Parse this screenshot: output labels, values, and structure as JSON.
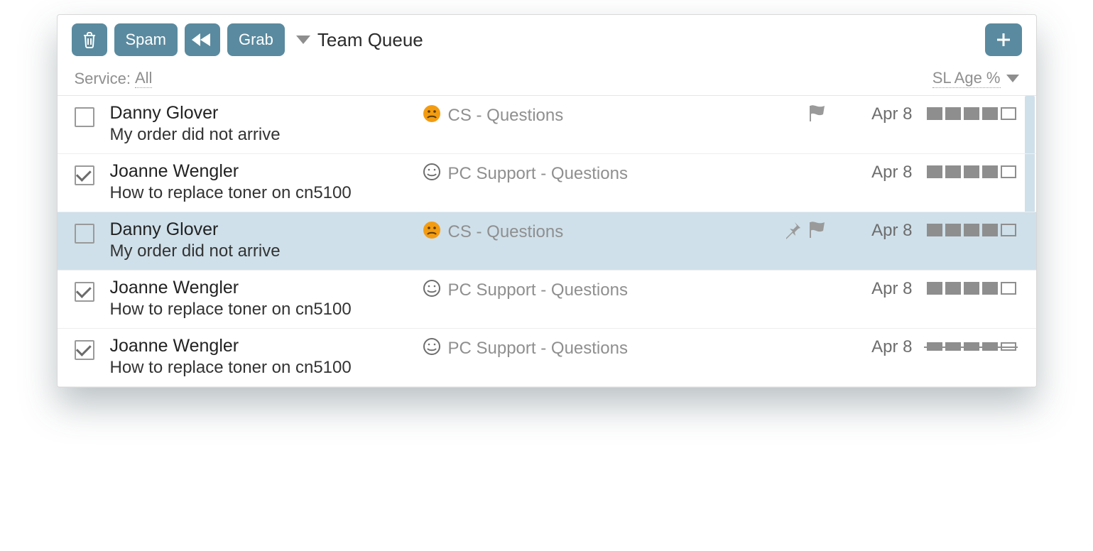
{
  "toolbar": {
    "spam_label": "Spam",
    "grab_label": "Grab",
    "queue_label": "Team Queue"
  },
  "filter": {
    "service_label": "Service:",
    "service_value": "All",
    "sort_label": "SL Age %"
  },
  "rows": [
    {
      "checked": false,
      "selected": false,
      "name": "Danny Glover",
      "subject": "My order did not arrive",
      "sentiment": "sad",
      "category": "CS - Questions",
      "pinned": false,
      "flagged": true,
      "date": "Apr 8",
      "bars": [
        1,
        1,
        1,
        1,
        0
      ],
      "bar_style": "normal"
    },
    {
      "checked": true,
      "selected": false,
      "name": "Joanne Wengler",
      "subject": "How to replace toner on cn5100",
      "sentiment": "happy",
      "category": "PC Support - Questions",
      "pinned": false,
      "flagged": false,
      "date": "Apr 8",
      "bars": [
        1,
        1,
        1,
        1,
        0
      ],
      "bar_style": "normal"
    },
    {
      "checked": false,
      "selected": true,
      "name": "Danny Glover",
      "subject": "My order did not arrive",
      "sentiment": "sad",
      "category": "CS - Questions",
      "pinned": true,
      "flagged": true,
      "date": "Apr 8",
      "bars": [
        1,
        1,
        1,
        1,
        0
      ],
      "bar_style": "normal"
    },
    {
      "checked": true,
      "selected": false,
      "name": "Joanne Wengler",
      "subject": "How to replace toner on cn5100",
      "sentiment": "happy",
      "category": "PC Support - Questions",
      "pinned": false,
      "flagged": false,
      "date": "Apr 8",
      "bars": [
        1,
        1,
        1,
        1,
        0
      ],
      "bar_style": "normal"
    },
    {
      "checked": true,
      "selected": false,
      "name": "Joanne Wengler",
      "subject": "How to replace toner on cn5100",
      "sentiment": "happy",
      "category": "PC Support - Questions",
      "pinned": false,
      "flagged": false,
      "date": "Apr 8",
      "bars": [
        1,
        1,
        1,
        1,
        0
      ],
      "bar_style": "strike"
    }
  ],
  "colors": {
    "button": "#5a8a9f",
    "selected_row": "#cfe0ea",
    "sad_emoji": "#f39c12"
  }
}
